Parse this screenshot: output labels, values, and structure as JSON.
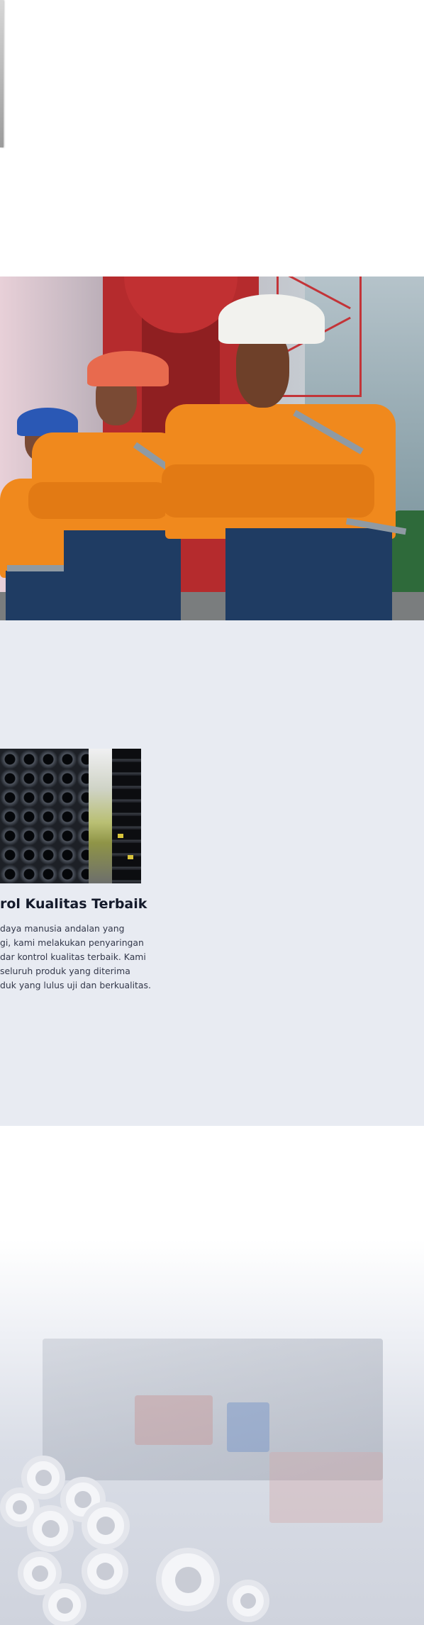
{
  "quality_section": {
    "title": "rol Kualitas Terbaik",
    "body_lines": [
      "daya manusia andalan yang",
      "gi, kami melakukan penyaringan",
      "dar kontrol kualitas terbaik. Kami",
      "seluruh produk yang diterima",
      "duk yang lulus uji dan berkualitas."
    ]
  },
  "colors": {
    "section_bg": "#e8ebf2",
    "title_color": "#141a2b",
    "body_text_color": "#33384a",
    "uniform_orange": "#f0891d",
    "crane_red": "#b52b2d"
  }
}
